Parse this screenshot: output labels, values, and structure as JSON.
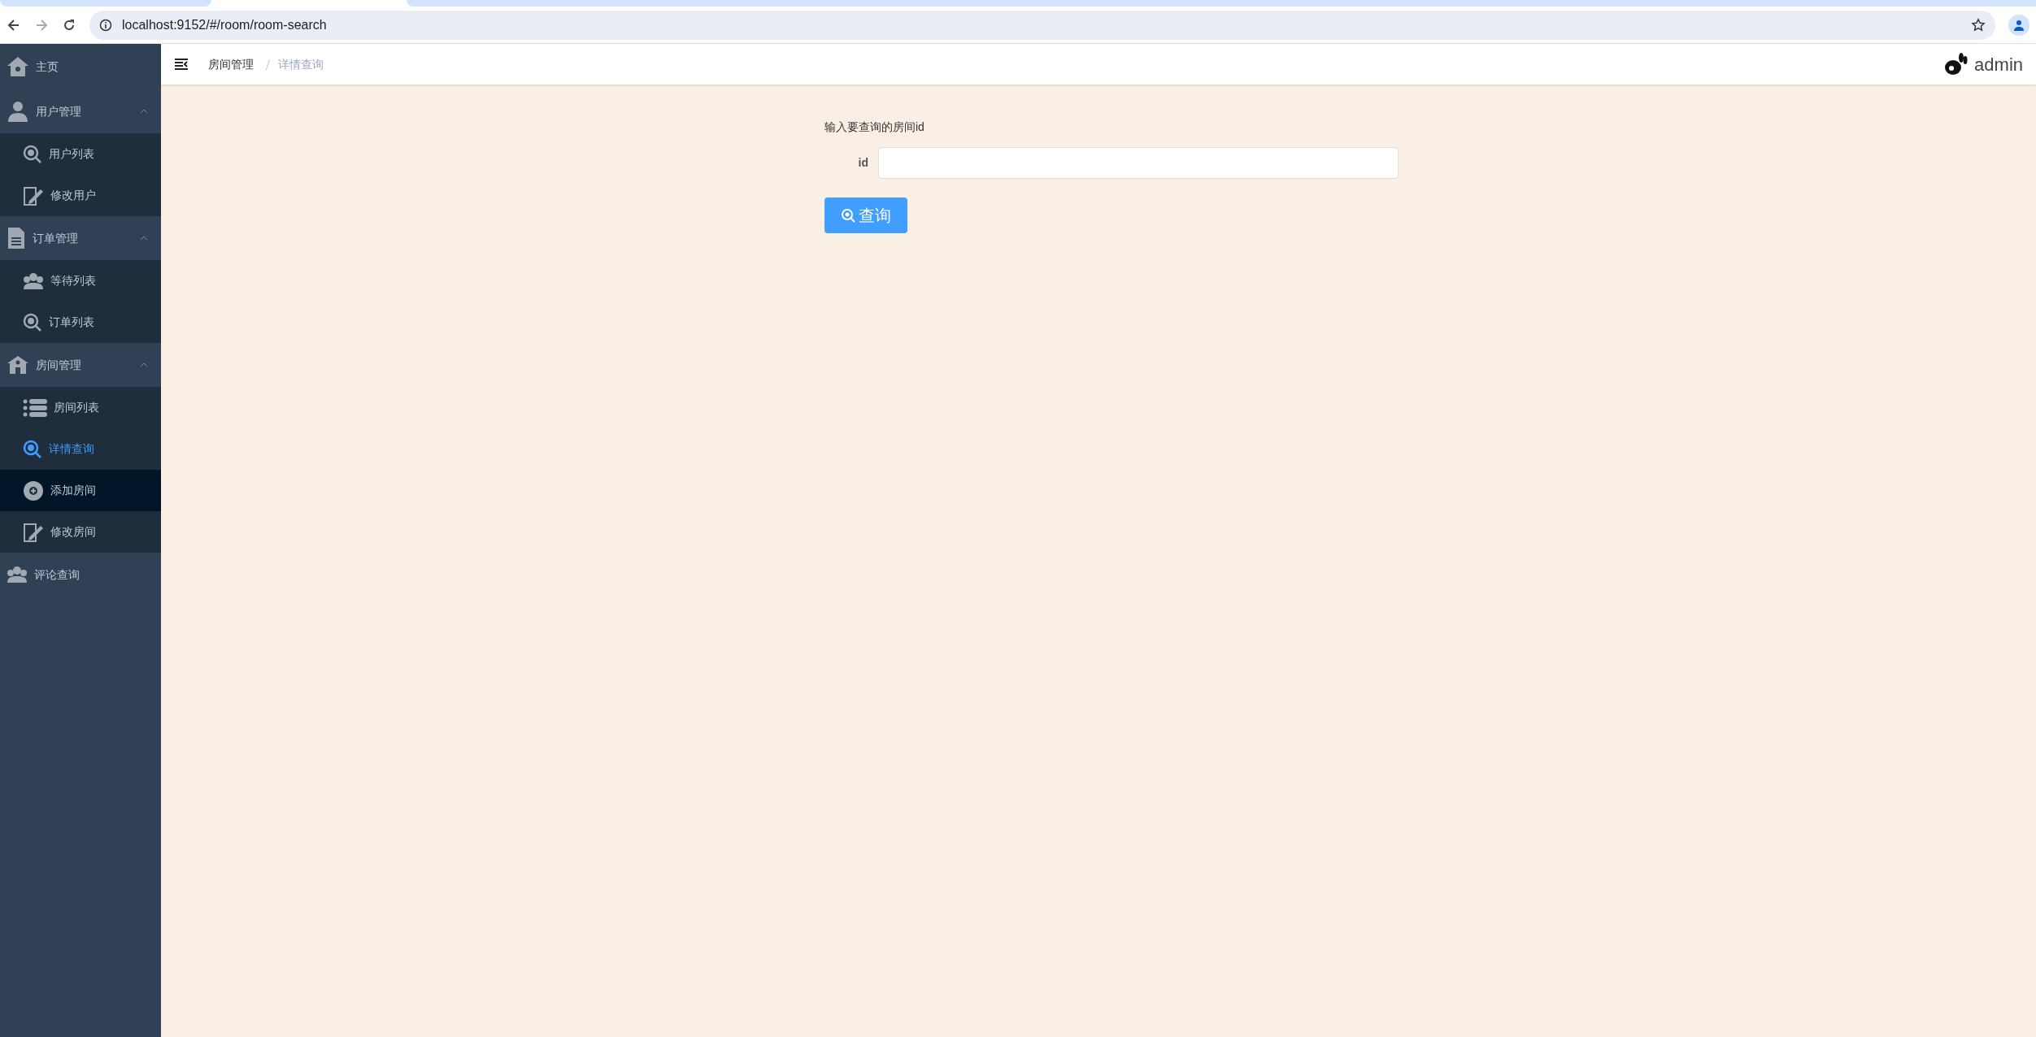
{
  "browser": {
    "url": "localhost:9152/#/room/room-search"
  },
  "sidebar": {
    "items": [
      {
        "label": "主页",
        "kind": "link"
      },
      {
        "label": "用户管理",
        "kind": "group",
        "expanded": true,
        "children": [
          {
            "label": "用户列表",
            "selected": false,
            "hovered": false
          },
          {
            "label": "修改用户",
            "selected": false,
            "hovered": false
          }
        ]
      },
      {
        "label": "订单管理",
        "kind": "group",
        "expanded": true,
        "children": [
          {
            "label": "等待列表",
            "selected": false,
            "hovered": false
          },
          {
            "label": "订单列表",
            "selected": false,
            "hovered": false
          }
        ]
      },
      {
        "label": "房间管理",
        "kind": "group",
        "expanded": true,
        "children": [
          {
            "label": "房间列表",
            "selected": false,
            "hovered": false
          },
          {
            "label": "详情查询",
            "selected": true,
            "hovered": false
          },
          {
            "label": "添加房间",
            "selected": false,
            "hovered": true
          },
          {
            "label": "修改房间",
            "selected": false,
            "hovered": false
          }
        ]
      },
      {
        "label": "评论查询",
        "kind": "link"
      }
    ]
  },
  "header": {
    "breadcrumb": [
      "房间管理",
      "详情查询"
    ],
    "user": "admin"
  },
  "form": {
    "title": "输入要查询的房间id",
    "field_label": "id",
    "button": "查询"
  }
}
